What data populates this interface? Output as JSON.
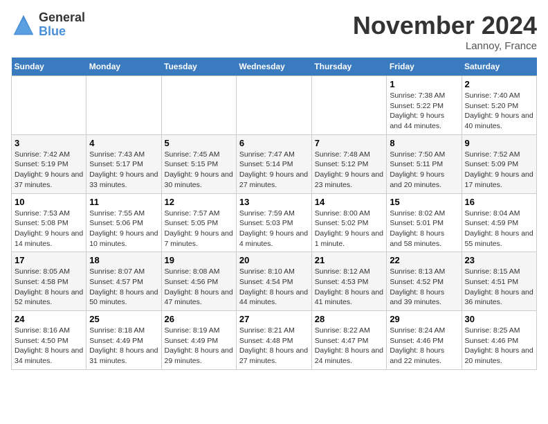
{
  "logo": {
    "general": "General",
    "blue": "Blue"
  },
  "title": "November 2024",
  "location": "Lannoy, France",
  "days_of_week": [
    "Sunday",
    "Monday",
    "Tuesday",
    "Wednesday",
    "Thursday",
    "Friday",
    "Saturday"
  ],
  "weeks": [
    [
      {
        "day": "",
        "info": ""
      },
      {
        "day": "",
        "info": ""
      },
      {
        "day": "",
        "info": ""
      },
      {
        "day": "",
        "info": ""
      },
      {
        "day": "",
        "info": ""
      },
      {
        "day": "1",
        "info": "Sunrise: 7:38 AM\nSunset: 5:22 PM\nDaylight: 9 hours and 44 minutes."
      },
      {
        "day": "2",
        "info": "Sunrise: 7:40 AM\nSunset: 5:20 PM\nDaylight: 9 hours and 40 minutes."
      }
    ],
    [
      {
        "day": "3",
        "info": "Sunrise: 7:42 AM\nSunset: 5:19 PM\nDaylight: 9 hours and 37 minutes."
      },
      {
        "day": "4",
        "info": "Sunrise: 7:43 AM\nSunset: 5:17 PM\nDaylight: 9 hours and 33 minutes."
      },
      {
        "day": "5",
        "info": "Sunrise: 7:45 AM\nSunset: 5:15 PM\nDaylight: 9 hours and 30 minutes."
      },
      {
        "day": "6",
        "info": "Sunrise: 7:47 AM\nSunset: 5:14 PM\nDaylight: 9 hours and 27 minutes."
      },
      {
        "day": "7",
        "info": "Sunrise: 7:48 AM\nSunset: 5:12 PM\nDaylight: 9 hours and 23 minutes."
      },
      {
        "day": "8",
        "info": "Sunrise: 7:50 AM\nSunset: 5:11 PM\nDaylight: 9 hours and 20 minutes."
      },
      {
        "day": "9",
        "info": "Sunrise: 7:52 AM\nSunset: 5:09 PM\nDaylight: 9 hours and 17 minutes."
      }
    ],
    [
      {
        "day": "10",
        "info": "Sunrise: 7:53 AM\nSunset: 5:08 PM\nDaylight: 9 hours and 14 minutes."
      },
      {
        "day": "11",
        "info": "Sunrise: 7:55 AM\nSunset: 5:06 PM\nDaylight: 9 hours and 10 minutes."
      },
      {
        "day": "12",
        "info": "Sunrise: 7:57 AM\nSunset: 5:05 PM\nDaylight: 9 hours and 7 minutes."
      },
      {
        "day": "13",
        "info": "Sunrise: 7:59 AM\nSunset: 5:03 PM\nDaylight: 9 hours and 4 minutes."
      },
      {
        "day": "14",
        "info": "Sunrise: 8:00 AM\nSunset: 5:02 PM\nDaylight: 9 hours and 1 minute."
      },
      {
        "day": "15",
        "info": "Sunrise: 8:02 AM\nSunset: 5:01 PM\nDaylight: 8 hours and 58 minutes."
      },
      {
        "day": "16",
        "info": "Sunrise: 8:04 AM\nSunset: 4:59 PM\nDaylight: 8 hours and 55 minutes."
      }
    ],
    [
      {
        "day": "17",
        "info": "Sunrise: 8:05 AM\nSunset: 4:58 PM\nDaylight: 8 hours and 52 minutes."
      },
      {
        "day": "18",
        "info": "Sunrise: 8:07 AM\nSunset: 4:57 PM\nDaylight: 8 hours and 50 minutes."
      },
      {
        "day": "19",
        "info": "Sunrise: 8:08 AM\nSunset: 4:56 PM\nDaylight: 8 hours and 47 minutes."
      },
      {
        "day": "20",
        "info": "Sunrise: 8:10 AM\nSunset: 4:54 PM\nDaylight: 8 hours and 44 minutes."
      },
      {
        "day": "21",
        "info": "Sunrise: 8:12 AM\nSunset: 4:53 PM\nDaylight: 8 hours and 41 minutes."
      },
      {
        "day": "22",
        "info": "Sunrise: 8:13 AM\nSunset: 4:52 PM\nDaylight: 8 hours and 39 minutes."
      },
      {
        "day": "23",
        "info": "Sunrise: 8:15 AM\nSunset: 4:51 PM\nDaylight: 8 hours and 36 minutes."
      }
    ],
    [
      {
        "day": "24",
        "info": "Sunrise: 8:16 AM\nSunset: 4:50 PM\nDaylight: 8 hours and 34 minutes."
      },
      {
        "day": "25",
        "info": "Sunrise: 8:18 AM\nSunset: 4:49 PM\nDaylight: 8 hours and 31 minutes."
      },
      {
        "day": "26",
        "info": "Sunrise: 8:19 AM\nSunset: 4:49 PM\nDaylight: 8 hours and 29 minutes."
      },
      {
        "day": "27",
        "info": "Sunrise: 8:21 AM\nSunset: 4:48 PM\nDaylight: 8 hours and 27 minutes."
      },
      {
        "day": "28",
        "info": "Sunrise: 8:22 AM\nSunset: 4:47 PM\nDaylight: 8 hours and 24 minutes."
      },
      {
        "day": "29",
        "info": "Sunrise: 8:24 AM\nSunset: 4:46 PM\nDaylight: 8 hours and 22 minutes."
      },
      {
        "day": "30",
        "info": "Sunrise: 8:25 AM\nSunset: 4:46 PM\nDaylight: 8 hours and 20 minutes."
      }
    ]
  ]
}
